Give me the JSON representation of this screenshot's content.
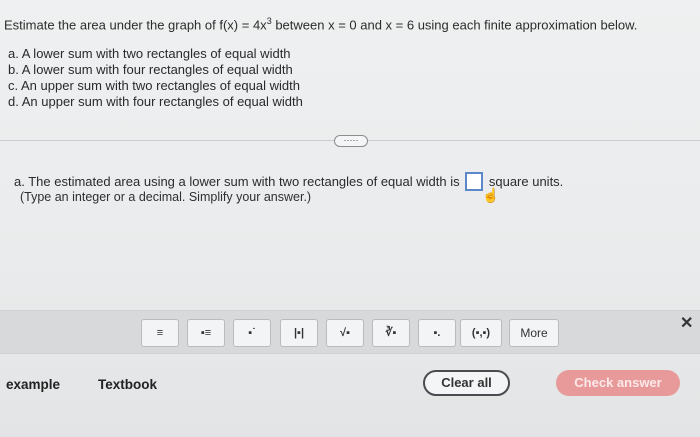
{
  "question": {
    "prefix": "Estimate the area under the graph of f(x) = 4x",
    "exponent": "3",
    "suffix": " between x = 0 and x = 6 using each finite approximation below."
  },
  "parts": [
    "a. A lower sum with two rectangles of equal width",
    "b. A lower sum with four rectangles of equal width",
    "c. An upper sum with two rectangles of equal width",
    "d. An upper sum with four rectangles of equal width"
  ],
  "expand_label": "·····",
  "answer": {
    "prefix": "a. The estimated area using a lower sum with two rectangles of equal width is",
    "value": "",
    "suffix": "square units.",
    "hint": "(Type an integer or a decimal. Simplify your answer.)"
  },
  "toolbar": {
    "tools": [
      {
        "name": "fraction-tool",
        "glyph": "≡"
      },
      {
        "name": "mixed-number-tool",
        "glyph": "▪≡"
      },
      {
        "name": "exponent-tool",
        "glyph": "▪˙"
      },
      {
        "name": "absolute-value-tool",
        "glyph": "|▪|"
      },
      {
        "name": "square-root-tool",
        "glyph": "√▪"
      },
      {
        "name": "nth-root-tool",
        "glyph": "∛▪"
      },
      {
        "name": "decimal-tool",
        "glyph": "▪."
      },
      {
        "name": "ordered-pair-tool",
        "glyph": "(▪,▪)"
      }
    ],
    "more_label": "More",
    "close_glyph": "✕"
  },
  "footer": {
    "example_label": "example",
    "textbook_label": "Textbook",
    "clear_label": "Clear all",
    "check_label": "Check answer"
  }
}
